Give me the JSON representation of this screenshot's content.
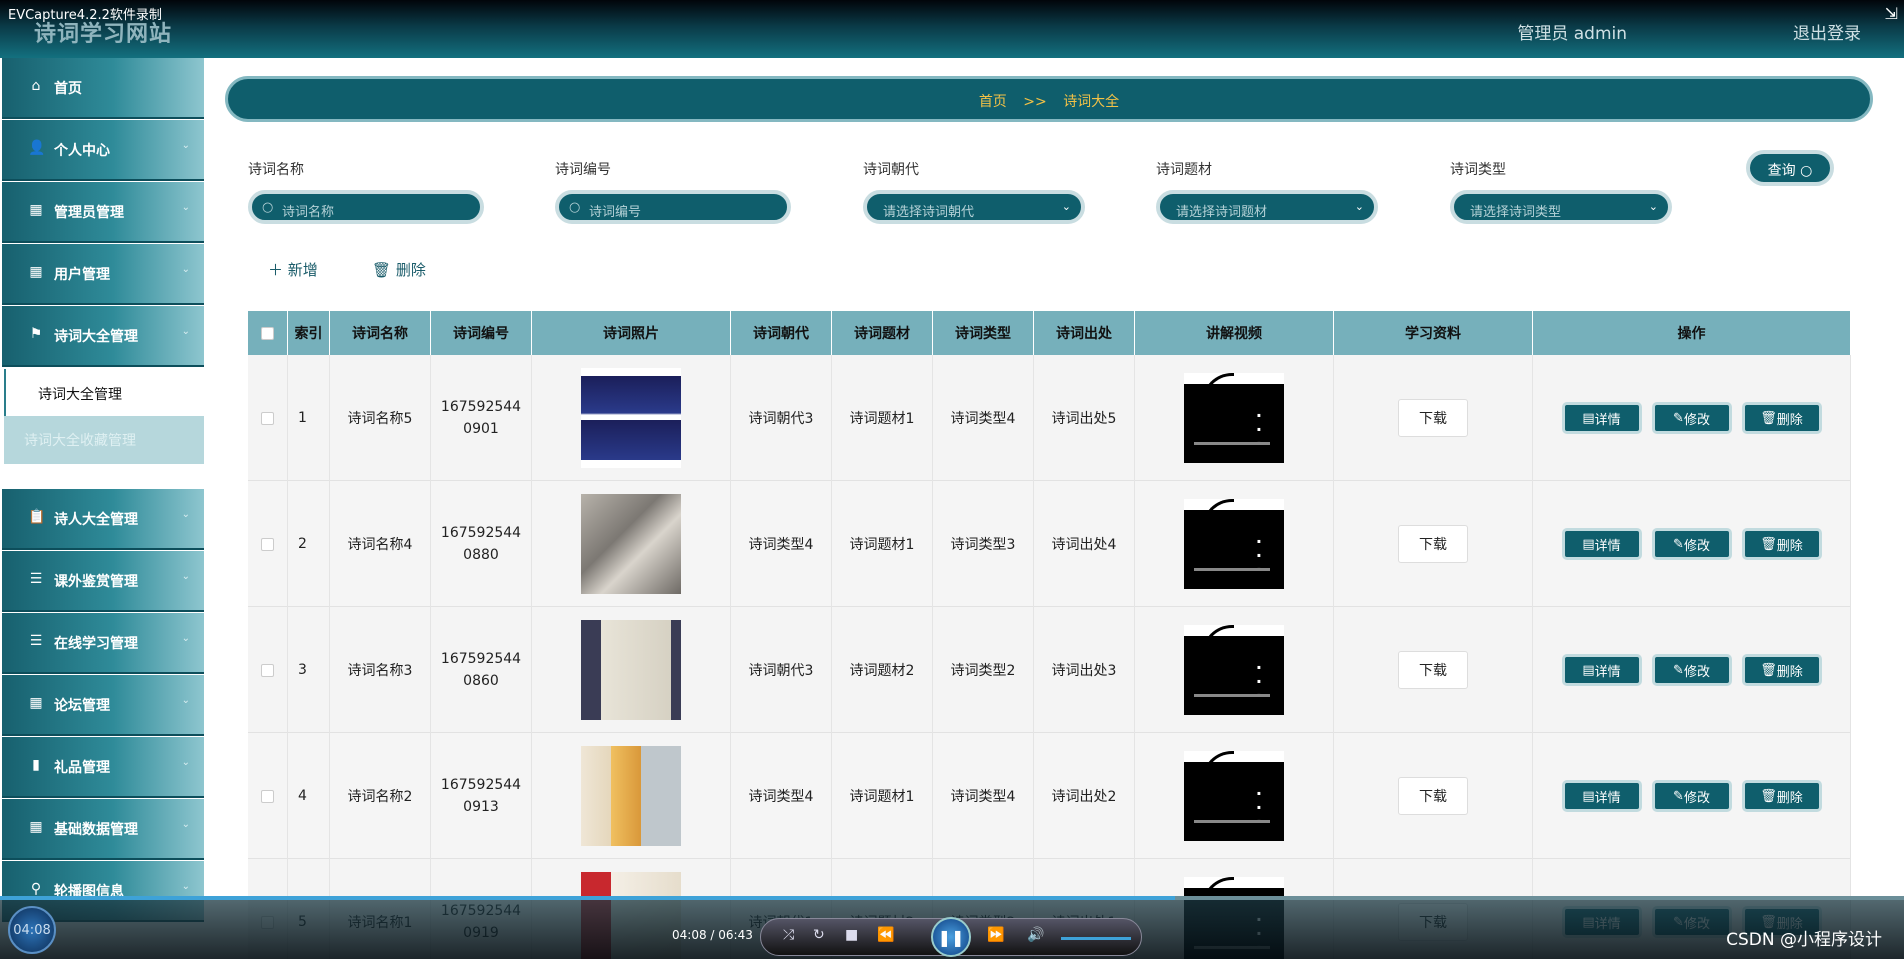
{
  "recorder": {
    "title": "EVCapture4.2.2软件录制"
  },
  "header": {
    "site_title": "诗词学习网站",
    "admin_label": "管理员 admin",
    "logout_label": "退出登录"
  },
  "sidebar": {
    "items": [
      {
        "label": "首页",
        "icon": "home-icon"
      },
      {
        "label": "个人中心",
        "icon": "user-icon"
      },
      {
        "label": "管理员管理",
        "icon": "grid-icon"
      },
      {
        "label": "用户管理",
        "icon": "grid-icon"
      },
      {
        "label": "诗词大全管理",
        "icon": "flag-icon"
      },
      {
        "label": "诗人大全管理",
        "icon": "clipboard-icon"
      },
      {
        "label": "课外鉴赏管理",
        "icon": "list-icon"
      },
      {
        "label": "在线学习管理",
        "icon": "list-icon"
      },
      {
        "label": "论坛管理",
        "icon": "grid-icon"
      },
      {
        "label": "礼品管理",
        "icon": "bar-chart-icon"
      },
      {
        "label": "基础数据管理",
        "icon": "grid-icon"
      },
      {
        "label": "轮播图信息",
        "icon": "pin-icon"
      }
    ],
    "sub_active": "诗词大全管理",
    "sub_faded": "诗词大全收藏管理"
  },
  "breadcrumb": {
    "home": "首页",
    "sep": ">>",
    "current": "诗词大全"
  },
  "search": {
    "name_label": "诗词名称",
    "name_placeholder": "诗词名称",
    "code_label": "诗词编号",
    "code_placeholder": "诗词编号",
    "dynasty_label": "诗词朝代",
    "dynasty_placeholder": "请选择诗词朝代",
    "theme_label": "诗词题材",
    "theme_placeholder": "请选择诗词题材",
    "type_label": "诗词类型",
    "type_placeholder": "请选择诗词类型",
    "query_label": "查询"
  },
  "actions": {
    "add": "新增",
    "delete": "删除"
  },
  "table": {
    "headers": [
      "索引",
      "诗词名称",
      "诗词编号",
      "诗词照片",
      "诗词朝代",
      "诗词题材",
      "诗词类型",
      "诗词出处",
      "讲解视频",
      "学习资料",
      "操作"
    ],
    "download_label": "下载",
    "op_detail": "详情",
    "op_edit": "修改",
    "op_delete": "删除",
    "rows": [
      {
        "index": "1",
        "name": "诗词名称5",
        "code1": "167592544",
        "code2": "0901",
        "dynasty": "诗词朝代3",
        "theme": "诗词题材1",
        "type": "诗词类型4",
        "source": "诗词出处5"
      },
      {
        "index": "2",
        "name": "诗词名称4",
        "code1": "167592544",
        "code2": "0880",
        "dynasty": "诗词类型4",
        "theme": "诗词题材1",
        "type": "诗词类型3",
        "source": "诗词出处4"
      },
      {
        "index": "3",
        "name": "诗词名称3",
        "code1": "167592544",
        "code2": "0860",
        "dynasty": "诗词朝代3",
        "theme": "诗词题材2",
        "type": "诗词类型2",
        "source": "诗词出处3"
      },
      {
        "index": "4",
        "name": "诗词名称2",
        "code1": "167592544",
        "code2": "0913",
        "dynasty": "诗词类型4",
        "theme": "诗词题材1",
        "type": "诗词类型4",
        "source": "诗词出处2"
      },
      {
        "index": "5",
        "name": "诗词名称1",
        "code1": "167592544",
        "code2": "0919",
        "dynasty": "诗词朝代1",
        "theme": "诗词题材2",
        "type": "诗词类型2",
        "source": "诗词出处1"
      }
    ]
  },
  "player": {
    "clock": "04:08",
    "time": "04:08 / 06:43",
    "progress": 0.617
  },
  "watermark": "CSDN @小程序设计",
  "colors": {
    "primary": "#0f5e6c",
    "header_row": "#76b0bb",
    "breadcrumb_text": "#f3c247"
  }
}
